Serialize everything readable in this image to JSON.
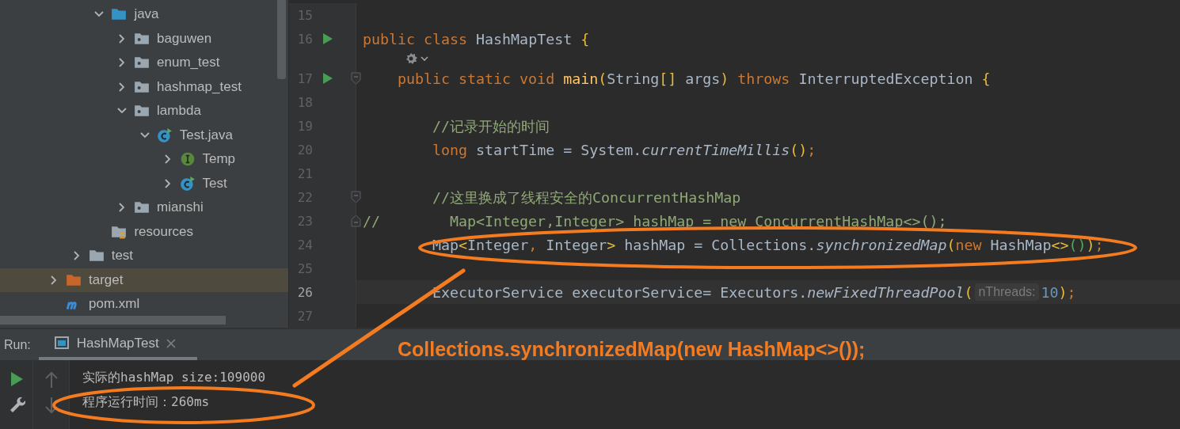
{
  "project_tree": {
    "items": [
      {
        "children": [
          {
            "children": [
              {
                "label": "java",
                "kind": "source-folder",
                "expanded": true,
                "selected": false,
                "children": [
                  {
                    "label": "baguwen",
                    "kind": "package",
                    "expanded": false,
                    "selected": false
                  },
                  {
                    "label": "enum_test",
                    "kind": "package",
                    "expanded": false,
                    "selected": false
                  },
                  {
                    "label": "hashmap_test",
                    "kind": "package",
                    "expanded": false,
                    "selected": false
                  },
                  {
                    "label": "lambda",
                    "kind": "package",
                    "expanded": true,
                    "selected": false,
                    "children": [
                      {
                        "label": "Test.java",
                        "kind": "class",
                        "expanded": true,
                        "selected": false,
                        "children": [
                          {
                            "label": "Temp",
                            "kind": "interface",
                            "expanded": false,
                            "selected": false
                          },
                          {
                            "label": "Test",
                            "kind": "class",
                            "expanded": false,
                            "selected": false
                          }
                        ]
                      }
                    ]
                  },
                  {
                    "label": "mianshi",
                    "kind": "package",
                    "expanded": false,
                    "selected": false
                  }
                ]
              },
              {
                "label": "resources",
                "kind": "resources",
                "selected": false
              }
            ]
          },
          {
            "label": "test",
            "kind": "folder",
            "expanded": false,
            "selected": false
          }
        ]
      },
      {
        "label": "target",
        "kind": "excluded-folder",
        "expanded": false,
        "selected": true
      },
      {
        "label": "pom.xml",
        "kind": "maven",
        "selected": false
      }
    ]
  },
  "editor": {
    "lines": [
      {
        "kind": "code",
        "number": "15",
        "current": false
      },
      {
        "kind": "code",
        "number": "16",
        "current": false,
        "runnable": true,
        "tokens": [
          {
            "text": "public class ",
            "kind": "keyword"
          },
          {
            "text": "HashMapTest ",
            "kind": "plain"
          },
          {
            "text": "{",
            "kind": "brace"
          }
        ]
      },
      {
        "kind": "inlay"
      },
      {
        "kind": "code",
        "number": "17",
        "current": false,
        "runnable": true,
        "fold_start": true,
        "tokens": [
          {
            "text": "    public static void ",
            "kind": "keyword"
          },
          {
            "text": "main",
            "kind": "declaration"
          },
          {
            "text": "(",
            "kind": "brace"
          },
          {
            "text": "String",
            "kind": "plain"
          },
          {
            "text": "[]",
            "kind": "brace"
          },
          {
            "text": " args",
            "kind": "plain"
          },
          {
            "text": ")",
            "kind": "brace"
          },
          {
            "text": " throws ",
            "kind": "keyword"
          },
          {
            "text": "InterruptedException ",
            "kind": "plain"
          },
          {
            "text": "{",
            "kind": "brace"
          }
        ]
      },
      {
        "kind": "code",
        "number": "18",
        "current": false
      },
      {
        "kind": "code",
        "number": "19",
        "current": false,
        "tokens": [
          {
            "text": "        //记录开始的时间",
            "kind": "comment"
          }
        ]
      },
      {
        "kind": "code",
        "number": "20",
        "current": false,
        "tokens": [
          {
            "text": "        long ",
            "kind": "keyword"
          },
          {
            "text": "startTime = System.",
            "kind": "plain"
          },
          {
            "text": "currentTimeMillis",
            "kind": "static-call"
          },
          {
            "text": "()",
            "kind": "brace"
          },
          {
            "text": ";",
            "kind": "keyword"
          }
        ]
      },
      {
        "kind": "code",
        "number": "21",
        "current": false
      },
      {
        "kind": "code",
        "number": "22",
        "current": false,
        "fold_start": true,
        "tokens": [
          {
            "text": "        //这里换成了线程安全的ConcurrentHashMap",
            "kind": "comment"
          }
        ]
      },
      {
        "kind": "code",
        "number": "23",
        "current": false,
        "fold_end": true,
        "tokens": [
          {
            "text": "//        Map<Integer,Integer> hashMap = new ConcurrentHashMap<>();",
            "kind": "comment"
          }
        ]
      },
      {
        "kind": "code",
        "number": "24",
        "current": false,
        "tokens": [
          {
            "text": "        Map",
            "kind": "plain"
          },
          {
            "text": "<",
            "kind": "brace"
          },
          {
            "text": "Integer",
            "kind": "plain"
          },
          {
            "text": ", ",
            "kind": "keyword"
          },
          {
            "text": "Integer",
            "kind": "plain"
          },
          {
            "text": ">",
            "kind": "brace"
          },
          {
            "text": " hashMap = Collections.",
            "kind": "plain"
          },
          {
            "text": "synchronizedMap",
            "kind": "static-call"
          },
          {
            "text": "(",
            "kind": "brace"
          },
          {
            "text": "new ",
            "kind": "keyword"
          },
          {
            "text": "HashMap",
            "kind": "plain"
          },
          {
            "text": "<>",
            "kind": "brace"
          },
          {
            "text": "()",
            "kind": "inner-brace"
          },
          {
            "text": ")",
            "kind": "brace"
          },
          {
            "text": ";",
            "kind": "keyword"
          }
        ]
      },
      {
        "kind": "code",
        "number": "25",
        "current": false
      },
      {
        "kind": "code",
        "number": "26",
        "current": true,
        "tokens": [
          {
            "text": "        ExecutorService executorService= Executors.",
            "kind": "plain"
          },
          {
            "text": "newFixedThreadPool",
            "kind": "static-call"
          },
          {
            "text": "(",
            "kind": "brace"
          },
          {
            "text": "nThreads:",
            "kind": "hint"
          },
          {
            "text": "10",
            "kind": "number"
          },
          {
            "text": ")",
            "kind": "brace"
          },
          {
            "text": ";",
            "kind": "keyword"
          }
        ]
      },
      {
        "kind": "code",
        "number": "27",
        "current": false
      }
    ]
  },
  "run_panel": {
    "label": "Run:",
    "tabs": [
      {
        "label": "HashMapTest",
        "selected": true
      }
    ],
    "console": {
      "lines": [
        "实际的hashMap size:109000",
        "程序运行时间：260ms"
      ]
    }
  },
  "annotation": {
    "caption": "Collections.synchronizedMap(new HashMap<>());"
  }
}
